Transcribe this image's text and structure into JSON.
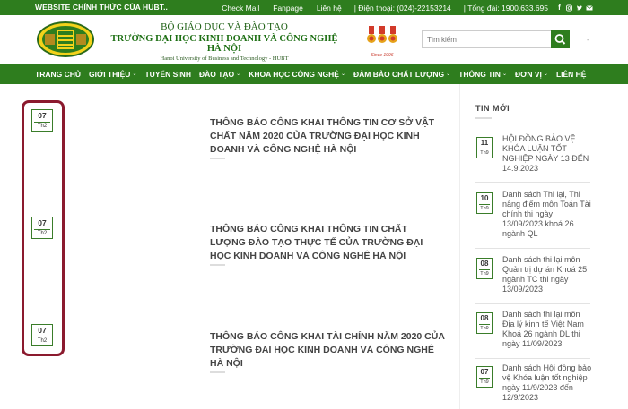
{
  "topbar": {
    "site_label": "WEBSITE CHÍNH THỨC CỦA HUBT..",
    "links": [
      {
        "label": "Check Mail"
      },
      {
        "label": "Fanpage"
      },
      {
        "label": "Liên hệ"
      },
      {
        "label": "| Điện thoại: (024)-22153214"
      },
      {
        "label": "| Tổng đài: 1900.633.695"
      }
    ],
    "social_icons": [
      "facebook-icon",
      "instagram-icon",
      "twitter-icon",
      "email-icon"
    ]
  },
  "header": {
    "ministry": "BỘ GIÁO DỤC VÀ ĐÀO TẠO",
    "university": "TRƯỜNG ĐẠI HỌC KINH DOANH VÀ CÔNG NGHỆ HÀ NỘI",
    "university_en": "Hanoi University of Business and Technology - HUBT",
    "since": "Since 1996",
    "search_placeholder": "Tìm kiếm",
    "dash": "-"
  },
  "nav": {
    "items": [
      {
        "label": "TRANG CHỦ",
        "dropdown": false
      },
      {
        "label": "GIỚI THIỆU",
        "dropdown": true
      },
      {
        "label": "TUYỂN SINH",
        "dropdown": false
      },
      {
        "label": "ĐÀO TẠO",
        "dropdown": true
      },
      {
        "label": "KHOA HỌC CÔNG NGHỆ",
        "dropdown": true
      },
      {
        "label": "ĐẢM BẢO CHẤT LƯỢNG",
        "dropdown": true
      },
      {
        "label": "THÔNG TIN",
        "dropdown": true
      },
      {
        "label": "ĐƠN VỊ",
        "dropdown": true
      },
      {
        "label": "LIÊN HỆ",
        "dropdown": false
      }
    ]
  },
  "posts": [
    {
      "day": "07",
      "month": "Th2",
      "title": "THÔNG BÁO CÔNG KHAI THÔNG TIN CƠ SỞ VẬT CHẤT NĂM 2020 CỦA TRƯỜNG ĐẠI HỌC KINH DOANH VÀ CÔNG NGHỆ HÀ NỘI"
    },
    {
      "day": "07",
      "month": "Th2",
      "title": "THÔNG BÁO CÔNG KHAI THÔNG TIN CHẤT LƯỢNG ĐÀO TẠO THỰC TẾ CỦA TRƯỜNG ĐẠI HỌC KINH DOANH VÀ CÔNG NGHỆ HÀ NỘI"
    },
    {
      "day": "07",
      "month": "Th2",
      "title": "THÔNG BÁO CÔNG KHAI TÀI CHÍNH NĂM 2020 CỦA TRƯỜNG ĐẠI HỌC KINH DOANH VÀ CÔNG NGHỆ HÀ NỘI"
    }
  ],
  "sidebar": {
    "title": "TIN MỚI",
    "items": [
      {
        "day": "11",
        "month": "Th9",
        "text": "HỘI ĐỒNG BẢO VỆ KHÓA LUẬN TỐT NGHIỆP NGÀY 13 ĐẾN 14.9.2023"
      },
      {
        "day": "10",
        "month": "Th9",
        "text": "Danh sách Thi lại, Thi nâng điểm môn Toán Tài chính thi ngày 13/09/2023 khoá 26 ngành QL"
      },
      {
        "day": "08",
        "month": "Th9",
        "text": "Danh sách thi lại môn Quản trị dự án Khoá 25 ngành TC thi ngày 13/09/2023"
      },
      {
        "day": "08",
        "month": "Th9",
        "text": "Danh sách thi lại môn Địa lý kinh tế Việt Nam Khoá 26 ngành DL thi ngày 11/09/2023"
      },
      {
        "day": "07",
        "month": "Th9",
        "text": "Danh sách Hội đồng bảo vệ Khóa luận tốt nghiệp ngày 11/9/2023 đến 12/9/2023"
      }
    ]
  },
  "colors": {
    "brand_green": "#2e7d1e",
    "highlight": "#8b1a2e"
  }
}
